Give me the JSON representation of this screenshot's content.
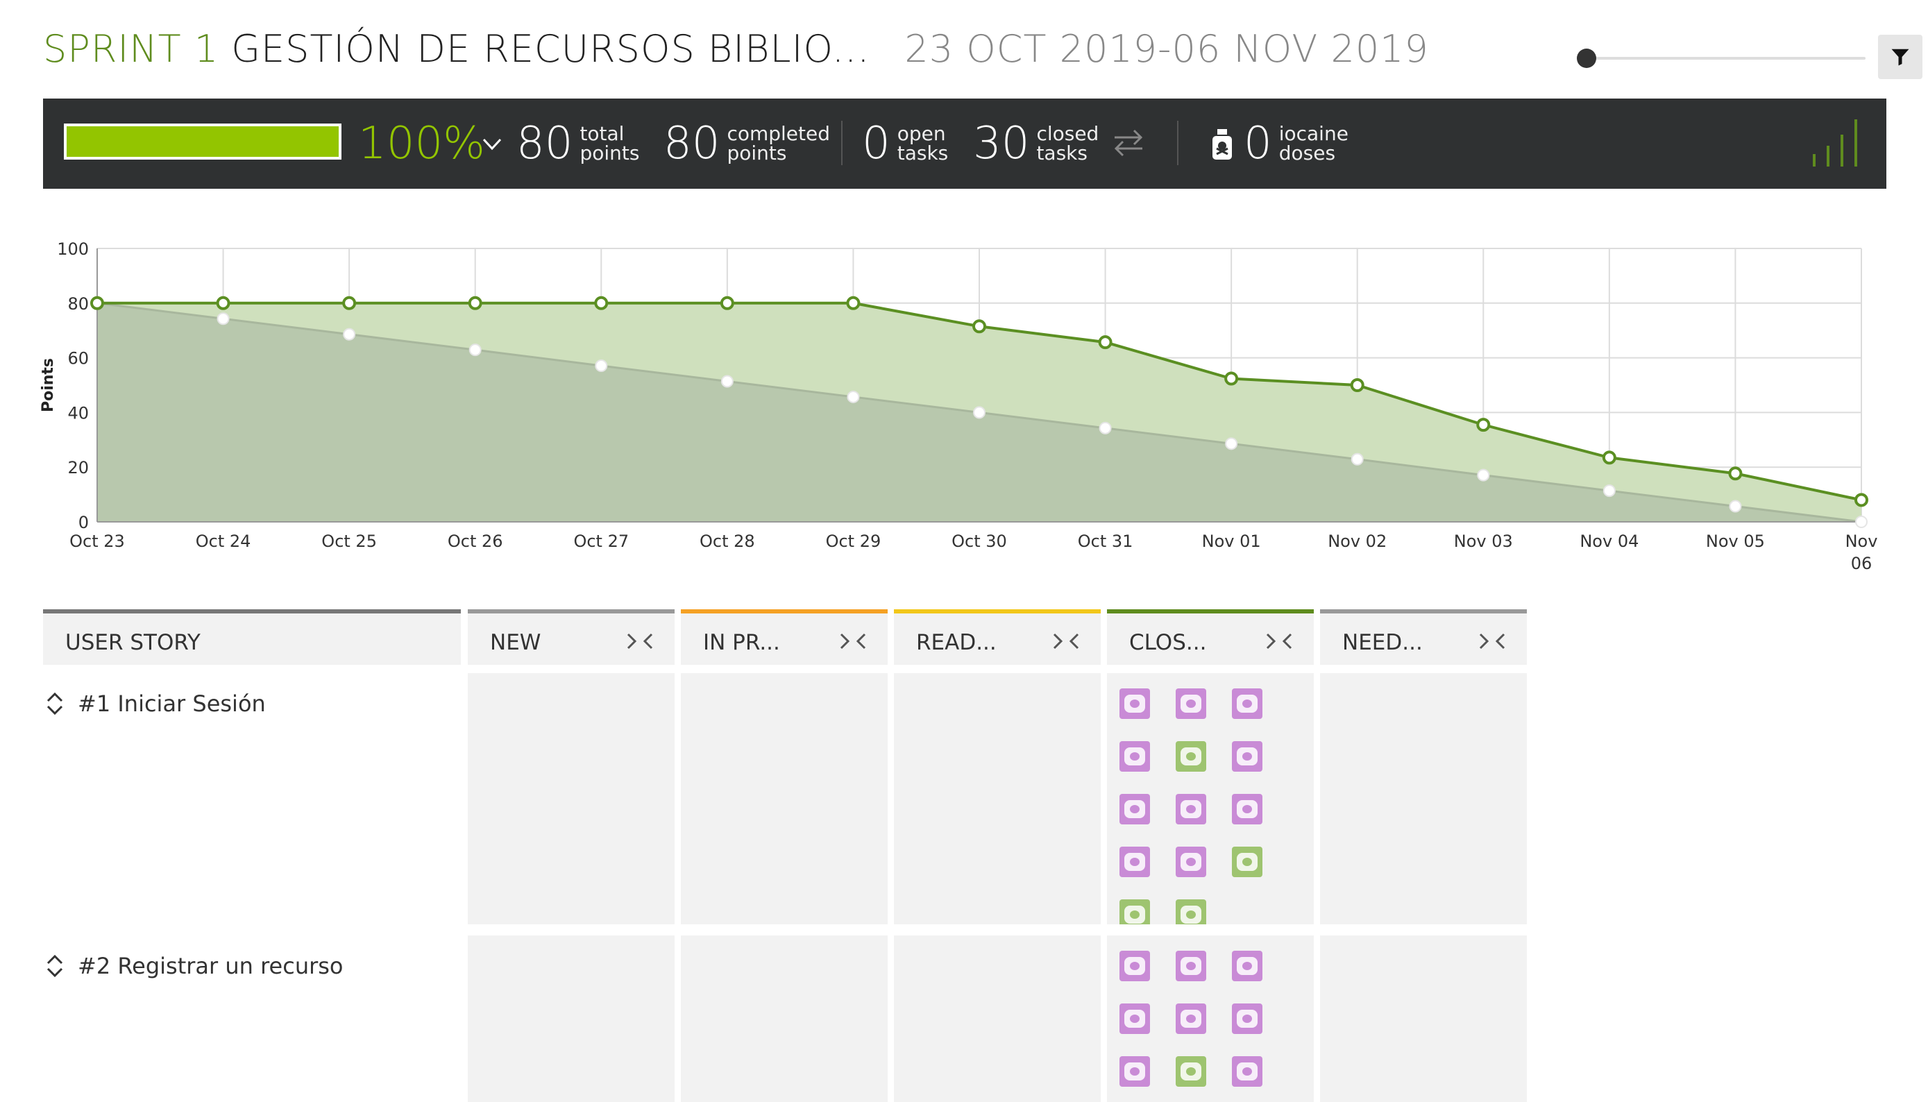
{
  "header": {
    "sprint_label": "SPRINT 1",
    "sprint_name": "GESTIÓN DE RECURSOS BIBLIO...",
    "dates": "23 OCT 2019-06 NOV 2019"
  },
  "stats": {
    "progress_fraction": 1.0,
    "percent_label": "100%",
    "total_points": {
      "value": "80",
      "label_1": "total",
      "label_2": "points"
    },
    "completed_points": {
      "value": "80",
      "label_1": "completed",
      "label_2": "points"
    },
    "open_tasks": {
      "value": "0",
      "label_1": "open",
      "label_2": "tasks"
    },
    "closed_tasks": {
      "value": "30",
      "label_1": "closed",
      "label_2": "tasks"
    },
    "iocaine": {
      "value": "0",
      "label_1": "iocaine",
      "label_2": "doses"
    }
  },
  "colors": {
    "accent_green": "#93c500",
    "sprint_green": "#5f8c1e",
    "stats_bg": "#2f3132",
    "chart_line": "#5b8f22",
    "chart_fill": "#cfe0bd",
    "chart_ideal_fill": "#b8c8ad",
    "task_pink": "#c98bd6",
    "task_green": "#9ec470"
  },
  "chart_data": {
    "type": "area",
    "ylabel": "Points",
    "ylim": [
      0,
      100
    ],
    "yticks": [
      "0",
      "20",
      "40",
      "60",
      "80",
      "100"
    ],
    "categories": [
      "Oct 23",
      "Oct 24",
      "Oct 25",
      "Oct 26",
      "Oct 27",
      "Oct 28",
      "Oct 29",
      "Oct 30",
      "Oct 31",
      "Nov 01",
      "Nov 02",
      "Nov 03",
      "Nov 04",
      "Nov 05",
      "Nov 06"
    ],
    "category_lines": [
      [
        "Oct 23"
      ],
      [
        "Oct 24"
      ],
      [
        "Oct 25"
      ],
      [
        "Oct 26"
      ],
      [
        "Oct 27"
      ],
      [
        "Oct 28"
      ],
      [
        "Oct 29"
      ],
      [
        "Oct 30"
      ],
      [
        "Oct 31"
      ],
      [
        "Nov 01"
      ],
      [
        "Nov 02"
      ],
      [
        "Nov 03"
      ],
      [
        "Nov 04"
      ],
      [
        "Nov 05"
      ],
      [
        "Nov",
        "06"
      ]
    ],
    "grid": true,
    "series": [
      {
        "values": [
          80,
          80,
          80,
          80,
          80,
          80,
          80,
          71.5,
          65.7,
          52.4,
          50,
          35.5,
          23.5,
          17.7,
          8
        ]
      },
      {
        "values": [
          80,
          74.3,
          68.6,
          62.9,
          57.1,
          51.4,
          45.7,
          40,
          34.3,
          28.6,
          22.9,
          17.1,
          11.4,
          5.7,
          0
        ]
      }
    ]
  },
  "kanban": {
    "user_story_header": "USER STORY",
    "columns": [
      {
        "title": "NEW",
        "color": "#999999"
      },
      {
        "title": "IN PR...",
        "color": "#f5a124"
      },
      {
        "title": "READ...",
        "color": "#f2c71a"
      },
      {
        "title": "CLOS...",
        "color": "#5f8c1e"
      },
      {
        "title": "NEED...",
        "color": "#999999"
      }
    ],
    "stories": [
      {
        "title": "#1 Iniciar Sesión",
        "closed_tasks": [
          "pink",
          "pink",
          "pink",
          "pink",
          "green",
          "pink",
          "pink",
          "pink",
          "pink",
          "pink",
          "pink",
          "green",
          "green",
          "green"
        ]
      },
      {
        "title": "#2 Registrar un recurso",
        "closed_tasks": [
          "pink",
          "pink",
          "pink",
          "pink",
          "pink",
          "pink",
          "pink",
          "green",
          "pink"
        ]
      }
    ]
  },
  "icons": {
    "filter": "filter-icon",
    "chevron": "chevron-down-icon",
    "swap": "swap-arrows-icon",
    "poison": "poison-bottle-icon",
    "signal": "signal-bars-icon",
    "fold": "fold-column-icon",
    "sort": "sort-arrows-icon"
  }
}
